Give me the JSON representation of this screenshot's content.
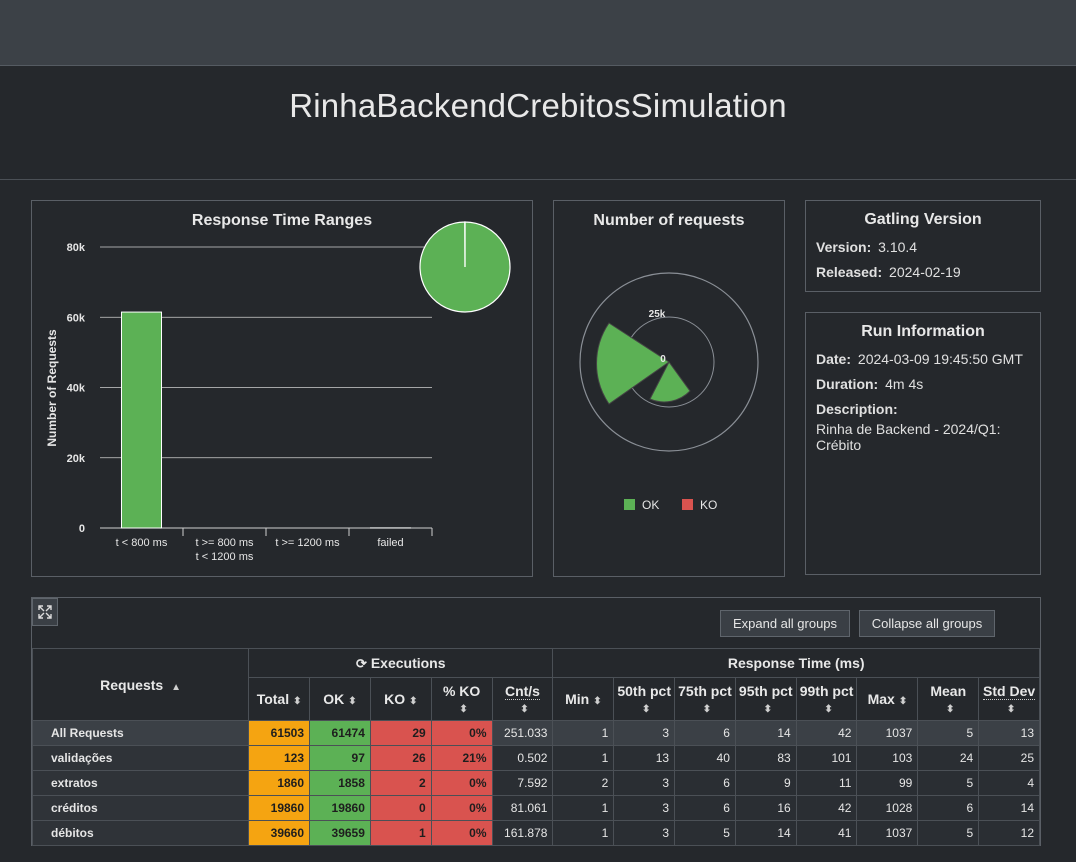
{
  "header": {
    "title": "RinhaBackendCrebitosSimulation"
  },
  "response_time_ranges": {
    "title": "Response Time Ranges",
    "chart_data": {
      "type": "bar",
      "categories": [
        "t < 800 ms",
        "t >= 800 ms\nt < 1200 ms",
        "t >= 1200 ms",
        "failed"
      ],
      "values": [
        61474,
        0,
        0,
        29
      ],
      "ylabel": "Number of Requests",
      "yticks": [
        "0",
        "20k",
        "40k",
        "60k",
        "80k"
      ],
      "ylim": [
        0,
        80000
      ],
      "colors": [
        "#5cb155",
        "#f5a411",
        "#d9534f",
        "#d9534f"
      ]
    },
    "pie": {
      "values": [
        61474,
        29
      ],
      "colors": [
        "#5cb155",
        "#d9534f"
      ]
    }
  },
  "number_of_requests": {
    "title": "Number of requests",
    "chart_data": {
      "type": "polar-area",
      "ticks": [
        "0",
        "25k"
      ],
      "legend": [
        {
          "label": "OK",
          "color": "#5cb155"
        },
        {
          "label": "KO",
          "color": "#d9534f"
        }
      ]
    }
  },
  "gatling": {
    "title": "Gatling Version",
    "version_label": "Version:",
    "version": "3.10.4",
    "released_label": "Released:",
    "released": "2024-02-19"
  },
  "run_info": {
    "title": "Run Information",
    "date_label": "Date:",
    "date": "2024-03-09 19:45:50 GMT",
    "duration_label": "Duration:",
    "duration": "4m 4s",
    "description_label": "Description:",
    "description": "Rinha de Backend - 2024/Q1: Crébito"
  },
  "toolbar": {
    "expand": "Expand all groups",
    "collapse": "Collapse all groups"
  },
  "table": {
    "requests_header": "Requests",
    "executions_header": "Executions",
    "response_time_header": "Response Time (ms)",
    "columns": [
      "Total",
      "OK",
      "KO",
      "% KO",
      "Cnt/s",
      "Min",
      "50th pct",
      "75th pct",
      "95th pct",
      "99th pct",
      "Max",
      "Mean",
      "Std Dev"
    ],
    "rows": [
      {
        "name": "All Requests",
        "cells": [
          "61503",
          "61474",
          "29",
          "0%",
          "251.033",
          "1",
          "3",
          "6",
          "14",
          "42",
          "1037",
          "5",
          "13"
        ]
      },
      {
        "name": "validações",
        "cells": [
          "123",
          "97",
          "26",
          "21%",
          "0.502",
          "1",
          "13",
          "40",
          "83",
          "101",
          "103",
          "24",
          "25"
        ]
      },
      {
        "name": "extratos",
        "cells": [
          "1860",
          "1858",
          "2",
          "0%",
          "7.592",
          "2",
          "3",
          "6",
          "9",
          "11",
          "99",
          "5",
          "4"
        ]
      },
      {
        "name": "créditos",
        "cells": [
          "19860",
          "19860",
          "0",
          "0%",
          "81.061",
          "1",
          "3",
          "6",
          "16",
          "42",
          "1028",
          "6",
          "14"
        ]
      },
      {
        "name": "débitos",
        "cells": [
          "39660",
          "39659",
          "1",
          "0%",
          "161.878",
          "1",
          "3",
          "5",
          "14",
          "41",
          "1037",
          "5",
          "12"
        ]
      }
    ]
  }
}
